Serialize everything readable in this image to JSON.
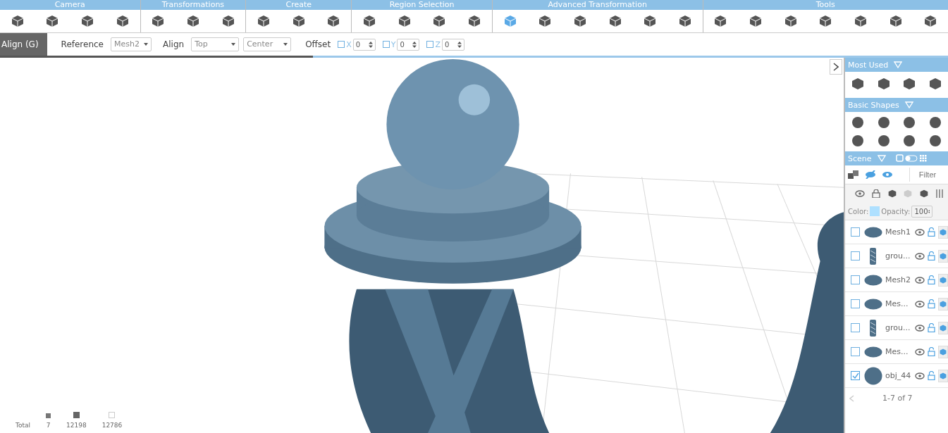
{
  "toolbar": [
    {
      "label": "Camera",
      "tools": [
        {
          "selected": false
        },
        {
          "selected": false
        },
        {
          "selected": false
        },
        {
          "selected": false
        }
      ]
    },
    {
      "label": "Transformations",
      "tools": [
        {
          "selected": false
        },
        {
          "selected": false
        },
        {
          "selected": false
        }
      ]
    },
    {
      "label": "Create",
      "tools": [
        {
          "selected": false
        },
        {
          "selected": false
        },
        {
          "selected": false
        }
      ]
    },
    {
      "label": "Region Selection",
      "tools": [
        {
          "selected": false
        },
        {
          "selected": false
        },
        {
          "selected": false
        },
        {
          "selected": false
        }
      ]
    },
    {
      "label": "Advanced Transformation",
      "tools": [
        {
          "selected": true
        },
        {
          "selected": false
        },
        {
          "selected": false
        },
        {
          "selected": false
        },
        {
          "selected": false
        },
        {
          "selected": false
        }
      ]
    },
    {
      "label": "Tools",
      "tools": [
        {
          "selected": false
        },
        {
          "selected": false
        },
        {
          "selected": false
        },
        {
          "selected": false
        },
        {
          "selected": false
        },
        {
          "selected": false
        },
        {
          "selected": false
        }
      ]
    }
  ],
  "options": {
    "mode": "Align (G)",
    "reference_label": "Reference",
    "reference": "Mesh2",
    "align_label": "Align",
    "align": "Top",
    "align_2": "Center",
    "offset_label": "Offset",
    "axes": [
      {
        "label": "X",
        "checked": false,
        "value": "0"
      },
      {
        "label": "Y",
        "checked": false,
        "value": "0"
      },
      {
        "label": "Z",
        "checked": false,
        "value": "0"
      }
    ]
  },
  "progress": {
    "level": 0.33
  },
  "stats": {
    "label": "Total",
    "values": [
      "7",
      "12198",
      "12786"
    ]
  },
  "panel": {
    "most_used": {
      "title": "Most Used"
    },
    "basic_shapes": {
      "title": "Basic Shapes"
    },
    "scene": {
      "title": "Scene",
      "filter_placeholder": "Filter",
      "color_label": "Color:",
      "color": "#aee0ff",
      "opacity_label": "Opacity:",
      "opacity": "100",
      "items": [
        {
          "name": "Mesh1",
          "kind": "disc",
          "checked": false
        },
        {
          "name": "grou...",
          "kind": "twist",
          "checked": false
        },
        {
          "name": "Mesh2",
          "kind": "disc",
          "checked": false
        },
        {
          "name": "Mes...",
          "kind": "disc",
          "checked": false
        },
        {
          "name": "grou...",
          "kind": "twist",
          "checked": false
        },
        {
          "name": "Mes...",
          "kind": "disc",
          "checked": false
        },
        {
          "name": "obj_44",
          "kind": "sphere",
          "checked": true
        }
      ],
      "pager": "1-7 of 7"
    }
  }
}
